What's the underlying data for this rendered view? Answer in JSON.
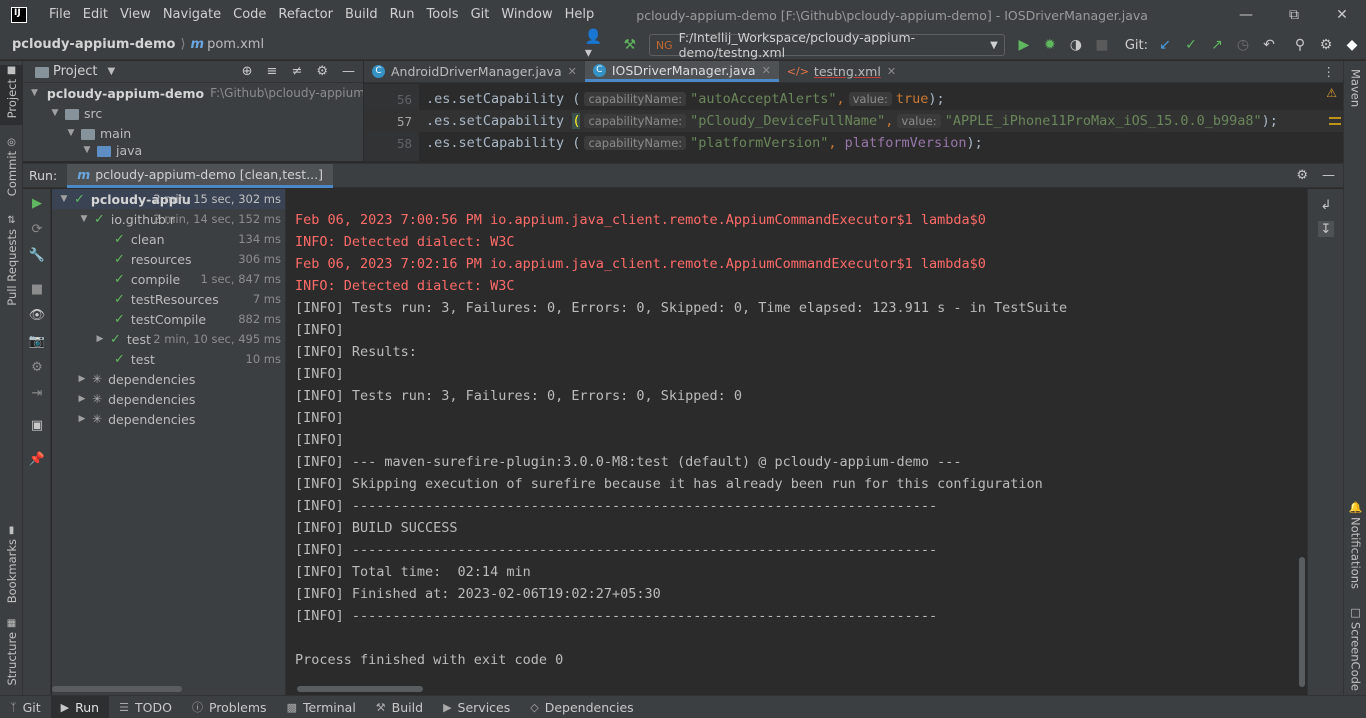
{
  "menu": [
    "File",
    "Edit",
    "View",
    "Navigate",
    "Code",
    "Refactor",
    "Build",
    "Run",
    "Tools",
    "Git",
    "Window",
    "Help"
  ],
  "window_title": "pcloudy-appium-demo [F:\\Github\\pcloudy-appium-demo] - IOSDriverManager.java",
  "breadcrumb": {
    "project": "pcloudy-appium-demo",
    "file": "pom.xml"
  },
  "run_config": "F:/Intellij_Workspace/pcloudy-appium-demo/testng.xml",
  "git_label": "Git:",
  "project_pane": {
    "title": "Project",
    "tree": [
      {
        "label": "pcloudy-appium-demo",
        "hint": "F:\\Github\\pcloudy-appium-de"
      },
      {
        "label": "src",
        "hint": ""
      },
      {
        "label": "main",
        "hint": ""
      },
      {
        "label": "java",
        "hint": ""
      }
    ]
  },
  "editor": {
    "tabs": [
      {
        "label": "AndroidDriverManager.java"
      },
      {
        "label": "IOSDriverManager.java"
      },
      {
        "label": "testng.xml"
      }
    ],
    "lines": [
      {
        "num": "56",
        "prefix": ".es.setCapability (",
        "hint1": "capabilityName:",
        "arg1": "\"autoAcceptAlerts\"",
        "sep": ",",
        "hint2": "value:",
        "arg2": "true",
        "suffix": ");"
      },
      {
        "num": "57",
        "prefix": ".es.setCapability ",
        "paren": "(",
        "hint1": "capabilityName:",
        "arg1": "\"pCloudy_DeviceFullName\"",
        "sep": ",",
        "hint2": "value:",
        "arg2": "\"APPLE_iPhone11ProMax_iOS_15.0.0_b99a8\"",
        "suffix": ");"
      },
      {
        "num": "58",
        "prefix": ".es.setCapability (",
        "hint1": "capabilityName:",
        "arg1": "\"platformVersion\"",
        "sep": ",",
        "hint2": "",
        "arg2": "platformVersion",
        "suffix": ");"
      }
    ]
  },
  "run_window": {
    "label": "Run:",
    "tab": "pcloudy-appium-demo [clean,test...]",
    "tree": [
      {
        "label": "pcloudy-appiu",
        "time": "2 min, 15 sec, 302 ms",
        "kind": "check",
        "bold": true
      },
      {
        "label": "io.github.r",
        "time": "2 min, 14 sec, 152 ms",
        "kind": "check"
      },
      {
        "label": "clean",
        "time": "134 ms",
        "kind": "check"
      },
      {
        "label": "resources",
        "time": "306 ms",
        "kind": "check"
      },
      {
        "label": "compile",
        "time": "1 sec, 847 ms",
        "kind": "check"
      },
      {
        "label": "testResources",
        "time": "7 ms",
        "kind": "check"
      },
      {
        "label": "testCompile",
        "time": "882 ms",
        "kind": "check"
      },
      {
        "label": "test",
        "time": "2 min, 10 sec, 495 ms",
        "kind": "check"
      },
      {
        "label": "test",
        "time": "10 ms",
        "kind": "check"
      },
      {
        "label": "dependencies",
        "time": "",
        "kind": "spin"
      },
      {
        "label": "dependencies",
        "time": "",
        "kind": "spin"
      },
      {
        "label": "dependencies",
        "time": "",
        "kind": "spin"
      }
    ],
    "console": [
      {
        "text": "Feb 06, 2023 7:00:56 PM io.appium.java_client.remote.AppiumCommandExecutor$1 lambda$0",
        "err": true
      },
      {
        "text": "INFO: Detected dialect: W3C",
        "err": true
      },
      {
        "text": "Feb 06, 2023 7:02:16 PM io.appium.java_client.remote.AppiumCommandExecutor$1 lambda$0",
        "err": true
      },
      {
        "text": "INFO: Detected dialect: W3C",
        "err": true
      },
      {
        "text": "[INFO] Tests run: 3, Failures: 0, Errors: 0, Skipped: 0, Time elapsed: 123.911 s - in TestSuite",
        "err": false
      },
      {
        "text": "[INFO]",
        "err": false
      },
      {
        "text": "[INFO] Results:",
        "err": false
      },
      {
        "text": "[INFO]",
        "err": false
      },
      {
        "text": "[INFO] Tests run: 3, Failures: 0, Errors: 0, Skipped: 0",
        "err": false
      },
      {
        "text": "[INFO]",
        "err": false
      },
      {
        "text": "[INFO]",
        "err": false
      },
      {
        "text": "[INFO] --- maven-surefire-plugin:3.0.0-M8:test (default) @ pcloudy-appium-demo ---",
        "err": false
      },
      {
        "text": "[INFO] Skipping execution of surefire because it has already been run for this configuration",
        "err": false
      },
      {
        "text": "[INFO] ------------------------------------------------------------------------",
        "err": false
      },
      {
        "text": "[INFO] BUILD SUCCESS",
        "err": false
      },
      {
        "text": "[INFO] ------------------------------------------------------------------------",
        "err": false
      },
      {
        "text": "[INFO] Total time:  02:14 min",
        "err": false
      },
      {
        "text": "[INFO] Finished at: 2023-02-06T19:02:27+05:30",
        "err": false
      },
      {
        "text": "[INFO] ------------------------------------------------------------------------",
        "err": false
      },
      {
        "text": "",
        "err": false
      },
      {
        "text": "Process finished with exit code 0",
        "err": false
      }
    ]
  },
  "left_strip": [
    "Project",
    "Commit",
    "Pull Requests",
    "Bookmarks",
    "Structure"
  ],
  "right_strip": [
    "Maven",
    "Notifications",
    "ScreenCode"
  ],
  "bottom_bar": [
    "Git",
    "Run",
    "TODO",
    "Problems",
    "Terminal",
    "Build",
    "Services",
    "Dependencies"
  ]
}
